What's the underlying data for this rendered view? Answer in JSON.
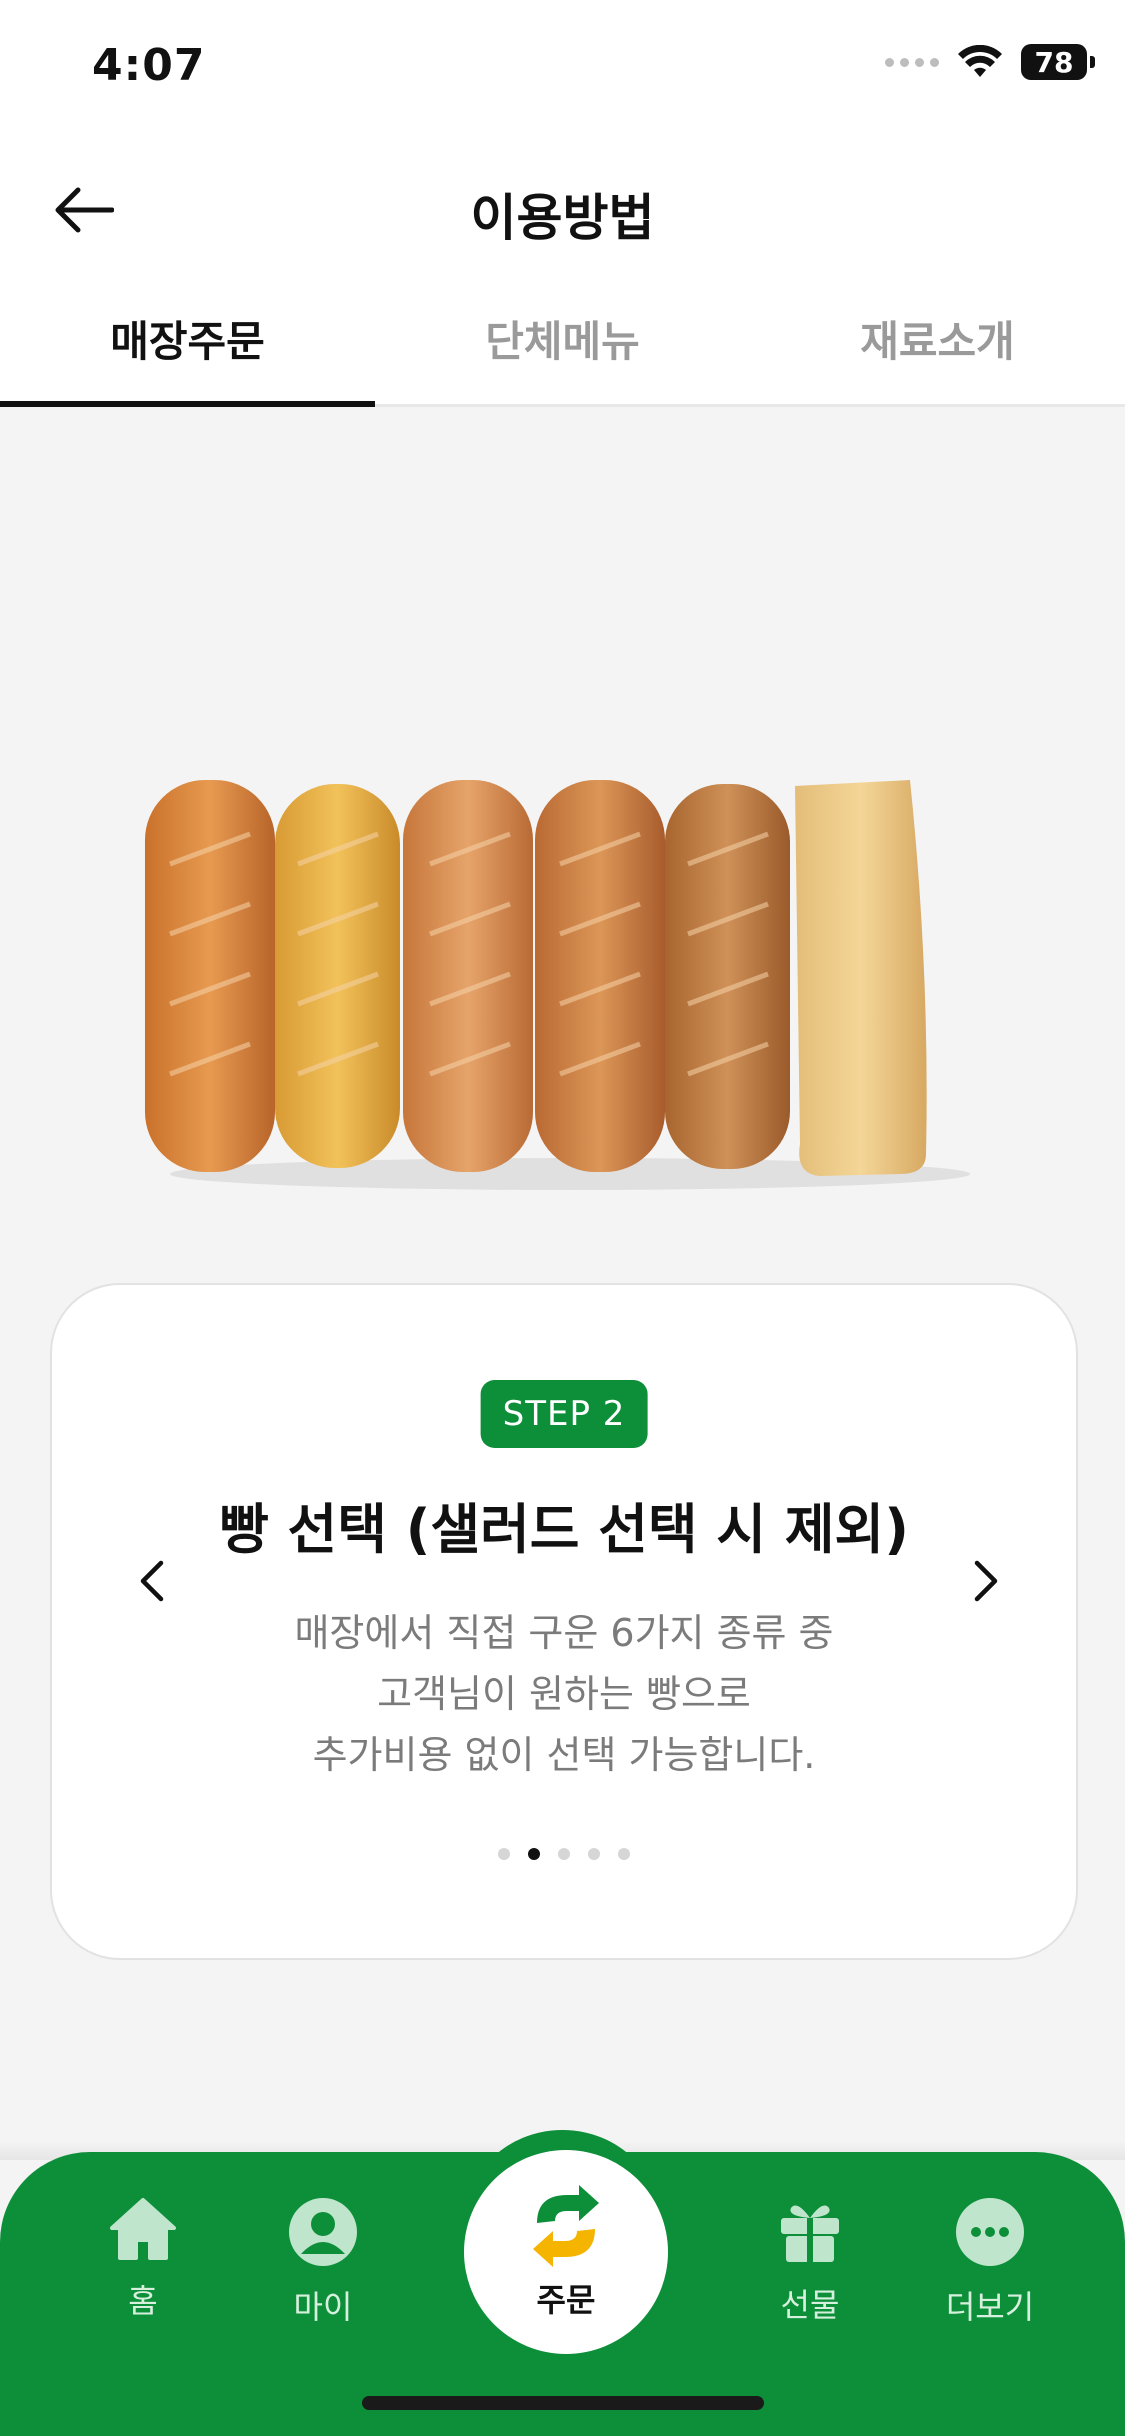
{
  "status_bar": {
    "time": "4:07",
    "battery": "78"
  },
  "header": {
    "title": "이용방법"
  },
  "tabs": [
    {
      "label": "매장주문",
      "active": true
    },
    {
      "label": "단체메뉴",
      "active": false
    },
    {
      "label": "재료소개",
      "active": false
    }
  ],
  "card": {
    "step_badge": "STEP 2",
    "title": "빵 선택 (샐러드 선택 시 제외)",
    "description_lines": [
      "매장에서 직접 구운 6가지 종류 중",
      "고객님이 원하는 빵으로",
      "추가비용 없이 선택 가능합니다."
    ],
    "pagination": {
      "total": 5,
      "current": 2
    }
  },
  "bottom_nav": [
    {
      "label": "홈",
      "icon": "home-icon"
    },
    {
      "label": "마이",
      "icon": "user-icon"
    },
    {
      "label": "주문",
      "icon": "subway-logo-icon"
    },
    {
      "label": "선물",
      "icon": "gift-icon"
    },
    {
      "label": "더보기",
      "icon": "more-icon"
    }
  ],
  "colors": {
    "brand_green": "#0d8f3a",
    "badge_green": "#0d8f3a"
  }
}
